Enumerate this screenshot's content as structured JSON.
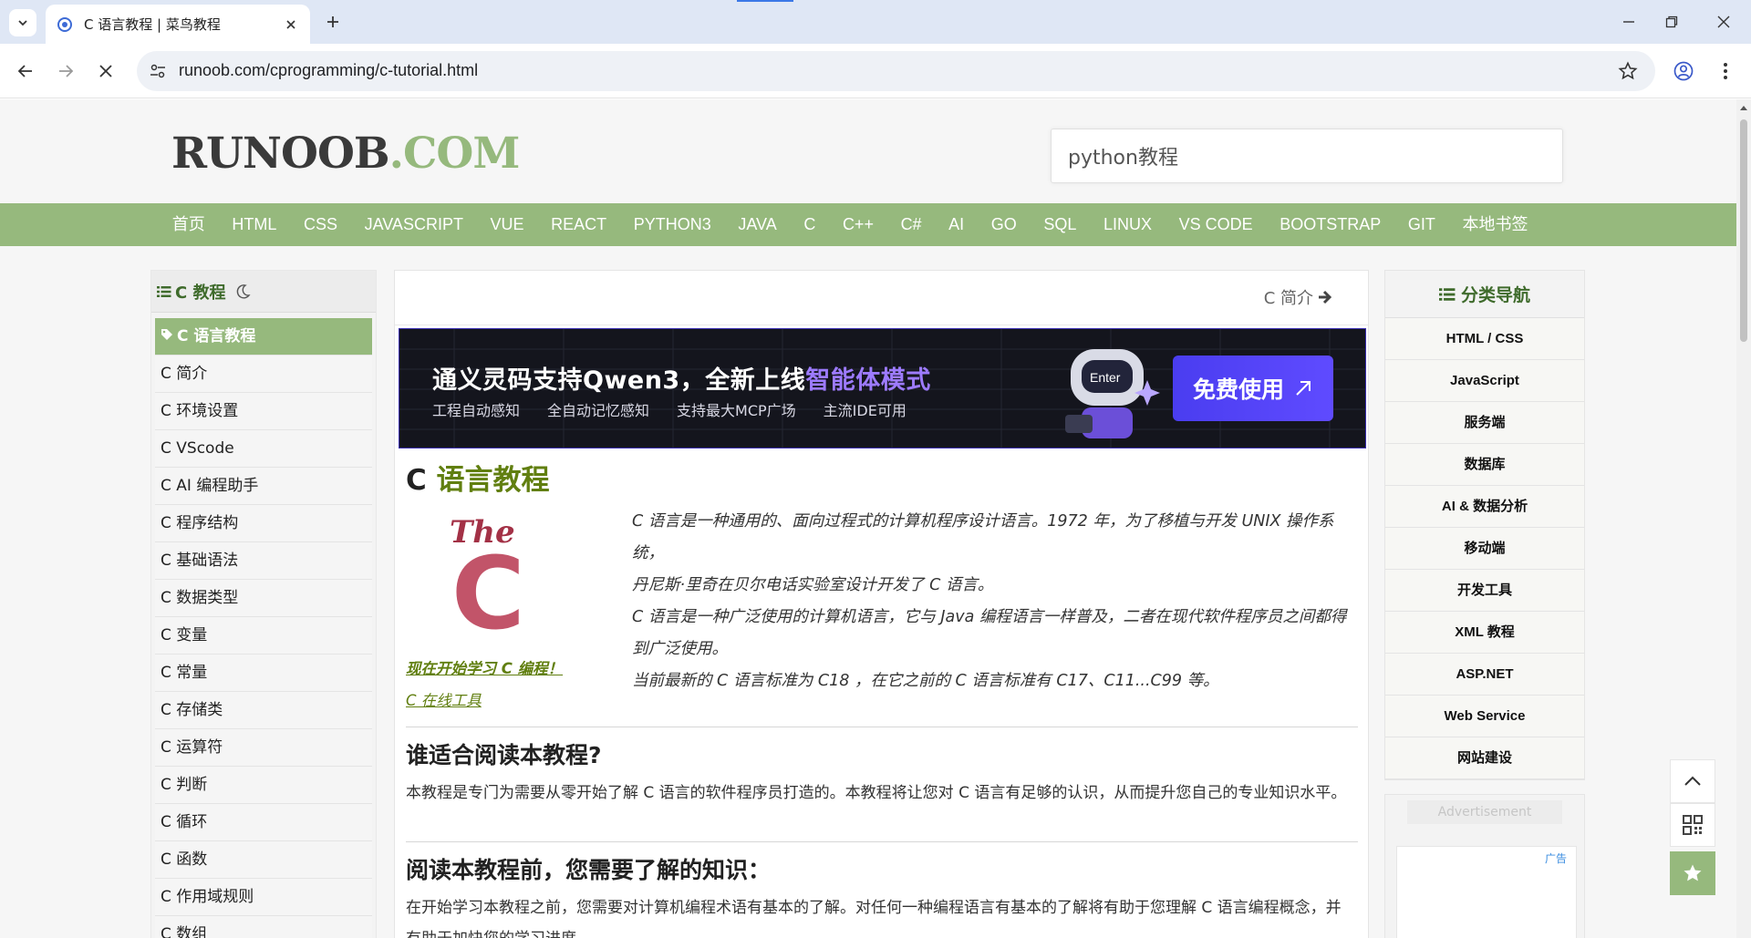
{
  "browser": {
    "tab_title": "C 语言教程 | 菜鸟教程",
    "url": "runoob.com/cprogramming/c-tutorial.html"
  },
  "header": {
    "logo_dark": "RUNOOB",
    "logo_green": ".COM",
    "search_value": "python教程"
  },
  "nav": {
    "items": [
      "首页",
      "HTML",
      "CSS",
      "JAVASCRIPT",
      "VUE",
      "REACT",
      "PYTHON3",
      "JAVA",
      "C",
      "C++",
      "C#",
      "AI",
      "GO",
      "SQL",
      "LINUX",
      "VS CODE",
      "BOOTSTRAP",
      "GIT",
      "本地书签"
    ]
  },
  "left": {
    "title": "C 教程",
    "items": [
      "C 语言教程",
      "C 简介",
      "C 环境设置",
      "C VScode",
      "C AI 编程助手",
      "C 程序结构",
      "C 基础语法",
      "C 数据类型",
      "C 变量",
      "C 常量",
      "C 存储类",
      "C 运算符",
      "C 判断",
      "C 循环",
      "C 函数",
      "C 作用域规则",
      "C 数组"
    ]
  },
  "content": {
    "next_label": "C 简介",
    "banner": {
      "title_white": "通义灵码支持Qwen3，全新上线",
      "title_purple": "智能体模式",
      "subs": [
        "工程自动感知",
        "全自动记忆感知",
        "支持最大MCP广场",
        "主流IDE可用"
      ],
      "button": "免费使用",
      "robot_screen": "Enter"
    },
    "h1_dark": "C ",
    "h1_green": "语言教程",
    "logo_the": "The",
    "logo_c": "C",
    "intro_lines": [
      "C 语言是一种通用的、面向过程式的计算机程序设计语言。1972 年，为了移植与开发 UNIX 操作系统，",
      "丹尼斯·里奇在贝尔电话实验室设计开发了 C 语言。",
      "C 语言是一种广泛使用的计算机语言，它与 Java 编程语言一样普及，二者在现代软件程序员之间都得",
      "到广泛使用。",
      "当前最新的 C 语言标准为 C18 ，在它之前的 C 语言标准有 C17、C11...C99 等。"
    ],
    "start_link": "现在开始学习 C 编程！",
    "online_link": "C 在线工具",
    "h2a": "谁适合阅读本教程?",
    "p1": "本教程是专门为需要从零开始了解 C 语言的软件程序员打造的。本教程将让您对 C 语言有足够的认识，从而提升您自己的专业知识水平。",
    "h2b": "阅读本教程前，您需要了解的知识：",
    "p2": "在开始学习本教程之前，您需要对计算机编程术语有基本的了解。对任何一种编程语言有基本的了解将有助于您理解 C 语言编程概念，并有助于加快您的学习进度。"
  },
  "right": {
    "title": "分类导航",
    "items": [
      "HTML / CSS",
      "JavaScript",
      "服务端",
      "数据库",
      "AI & 数据分析",
      "移动端",
      "开发工具",
      "XML 教程",
      "ASP.NET",
      "Web Service",
      "网站建设"
    ],
    "ad_label": "Advertisement",
    "ad_tag": "广告"
  },
  "colors": {
    "brand_green": "#96b97d",
    "link_green": "#617f10",
    "heading_green": "#3f6b2c",
    "banner_button": "#4a3df0"
  }
}
